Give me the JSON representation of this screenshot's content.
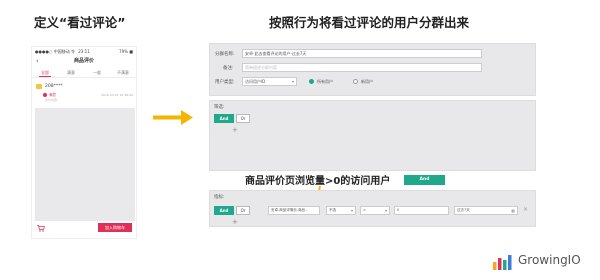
{
  "headings": {
    "left": "定义“看过评论”",
    "right": "按照行为将看过评论的用户分群出来"
  },
  "phone": {
    "status_left": "●●●●○ 中国移动 令",
    "status_time": "23:11",
    "status_battery": "79% ■",
    "back_icon": "chevron-left-icon",
    "title": "商品评价",
    "tabs": [
      "全部",
      "满意",
      "一般",
      "不满意"
    ],
    "review": {
      "user": "208****",
      "label": "满意",
      "time": "2016-03-22 10:36:08",
      "sub": "评价内容"
    },
    "cart_icon": "cart-icon",
    "cart_button": "加入购物车"
  },
  "form": {
    "name_label": "分群名称:",
    "name_value": "安卓-此去查看评论的用户-过去7天",
    "note_label": "备注:",
    "note_placeholder": "简单描述分群内容",
    "type_label": "用户类型:",
    "type_value": "访问用户ID",
    "radio_all": "所有用户",
    "radio_new": "新用户"
  },
  "filter": {
    "title": "筛选:",
    "and": "And",
    "or": "Or",
    "plus": "+"
  },
  "annotation": "商品评价页浏览量>0的访问用户",
  "float_and": "And",
  "metrics": {
    "title": "指标:",
    "and": "And",
    "or": "Or",
    "metric": "安卓-商品详情页-商品...",
    "field2": "不选",
    "op": ">",
    "value": "0",
    "range": "过去7天",
    "calendar_icon": "calendar-icon",
    "close_icon": "close-icon",
    "plus": "+"
  },
  "logo": {
    "text": "GrowingIO",
    "colors": [
      "#f5a623",
      "#e0305a",
      "#1fa88a",
      "#3b7dd8"
    ]
  }
}
